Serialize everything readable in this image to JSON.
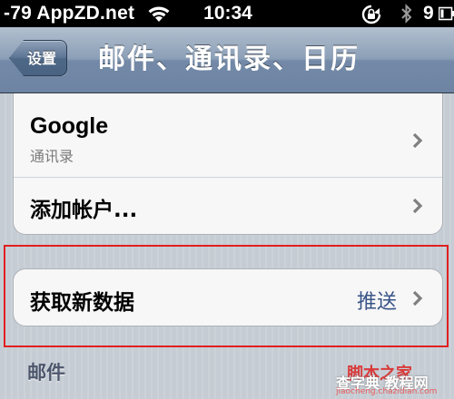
{
  "status_bar": {
    "carrier": "-79 AppZD.net",
    "time": "10:34",
    "battery_percent": "9",
    "icons": [
      "wifi-icon",
      "rotation-lock-icon",
      "bluetooth-icon",
      "battery-icon"
    ]
  },
  "nav": {
    "back_label": "设置",
    "title": "邮件、通讯录、日历"
  },
  "accounts": {
    "items": [
      {
        "title": "Google",
        "subtitle": "通讯录"
      },
      {
        "title": "添加帐户..."
      }
    ]
  },
  "fetch": {
    "title": "获取新数据",
    "value": "推送"
  },
  "sections": {
    "mail_header": "邮件"
  },
  "watermark": {
    "top": "脚本之家",
    "left": "查字典 教程网",
    "url": "jiaocheng.chazidian.com"
  },
  "colors": {
    "highlight": "#e0201f",
    "value_text": "#385487"
  }
}
